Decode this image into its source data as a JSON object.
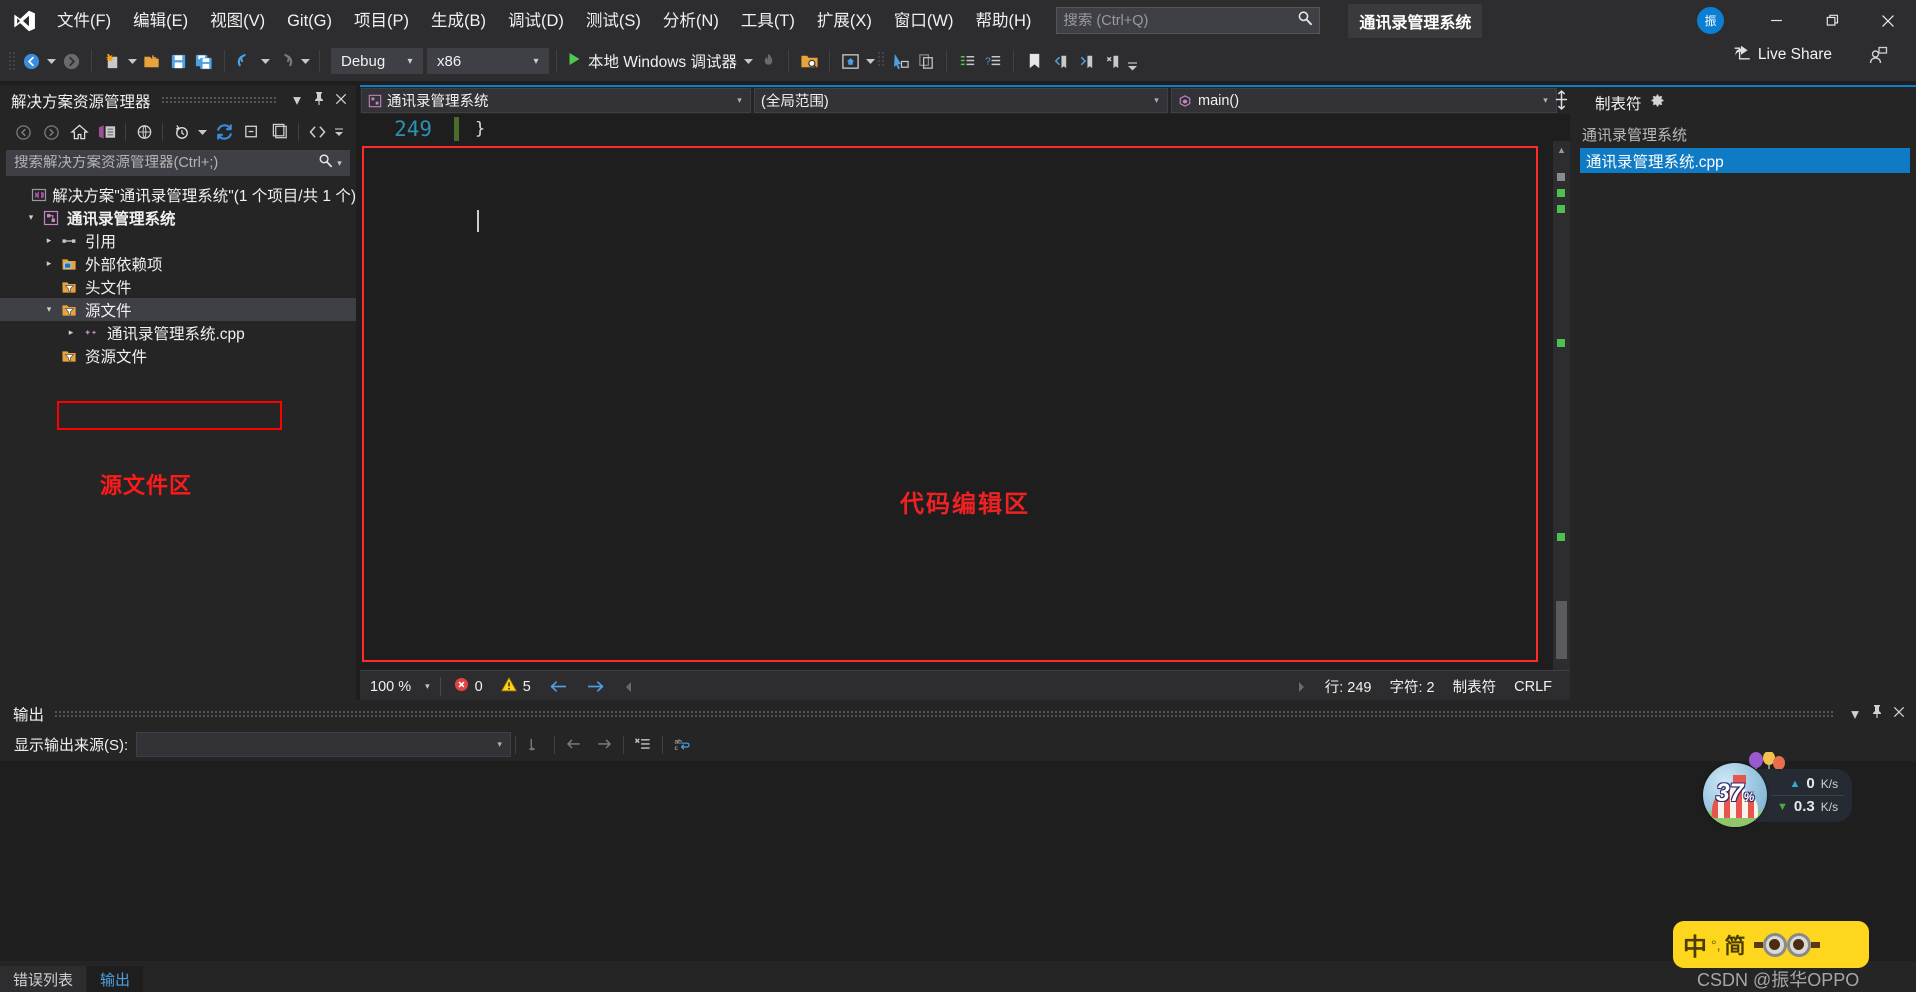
{
  "titlebar": {
    "logo_icon": "visual-studio-logo",
    "menus": [
      {
        "label": "文件(F)",
        "accel": "F"
      },
      {
        "label": "编辑(E)",
        "accel": "E"
      },
      {
        "label": "视图(V)",
        "accel": "V"
      },
      {
        "label": "Git(G)",
        "accel": "G"
      },
      {
        "label": "项目(P)",
        "accel": "P"
      },
      {
        "label": "生成(B)",
        "accel": "B"
      },
      {
        "label": "调试(D)",
        "accel": "D"
      },
      {
        "label": "测试(S)",
        "accel": "S"
      },
      {
        "label": "分析(N)",
        "accel": "N"
      },
      {
        "label": "工具(T)",
        "accel": "T"
      },
      {
        "label": "扩展(X)",
        "accel": "X"
      },
      {
        "label": "窗口(W)",
        "accel": "W"
      },
      {
        "label": "帮助(H)",
        "accel": "H"
      }
    ],
    "search": {
      "value": "",
      "placeholder": "搜索 (Ctrl+Q)"
    },
    "project_title": "通讯录管理系统",
    "avatar_initial": "振",
    "avatar_color": "#0b7fd4",
    "window_controls": [
      "minimize",
      "restore",
      "close"
    ]
  },
  "toolbar": {
    "config": "Debug",
    "platform": "x86",
    "run_label": "本地 Windows 调试器",
    "live_share": "Live Share"
  },
  "solution_explorer": {
    "title": "解决方案资源管理器",
    "search": {
      "value": "",
      "placeholder": "搜索解决方案资源管理器(Ctrl+;)"
    },
    "tree": [
      {
        "label": "解决方案\"通讯录管理系统\"(1 个项目/共 1 个)",
        "indent": 0,
        "twisty": "",
        "icon": "solution-icon",
        "bold": false,
        "selected": false,
        "highlighted": false
      },
      {
        "label": "通讯录管理系统",
        "indent": 1,
        "twisty": "expanded",
        "icon": "project-icon",
        "bold": true,
        "selected": false,
        "highlighted": false
      },
      {
        "label": "引用",
        "indent": 2,
        "twisty": "collapsed",
        "icon": "references-icon",
        "bold": false,
        "selected": false,
        "highlighted": false
      },
      {
        "label": "外部依赖项",
        "indent": 2,
        "twisty": "collapsed",
        "icon": "folder-dependency-icon",
        "bold": false,
        "selected": false,
        "highlighted": false
      },
      {
        "label": "头文件",
        "indent": 2,
        "twisty": "",
        "icon": "filter-folder-icon",
        "bold": false,
        "selected": false,
        "highlighted": false
      },
      {
        "label": "源文件",
        "indent": 2,
        "twisty": "expanded",
        "icon": "filter-folder-icon",
        "bold": false,
        "selected": true,
        "highlighted": false
      },
      {
        "label": "通讯录管理系统.cpp",
        "indent": 3,
        "twisty": "collapsed",
        "icon": "cpp-file-icon",
        "bold": false,
        "selected": false,
        "highlighted": true
      },
      {
        "label": "资源文件",
        "indent": 2,
        "twisty": "",
        "icon": "filter-folder-icon",
        "bold": false,
        "selected": false,
        "highlighted": false
      }
    ]
  },
  "annotations": {
    "source_area": "源文件区",
    "editor_area": "代码编辑区",
    "color": "#ff1a1a"
  },
  "editor": {
    "nav_project": "通讯录管理系统",
    "nav_scope": "(全局范围)",
    "nav_member": "main()",
    "line_number": "249",
    "code_text": "}"
  },
  "editor_status": {
    "zoom": "100 %",
    "errors": "0",
    "warnings": "5",
    "line": "行: 249",
    "column": "字符: 2",
    "tabs": "制表符",
    "eol": "CRLF"
  },
  "right_panel": {
    "title": "制表符",
    "group": "通讯录管理系统",
    "file": "通讯录管理系统.cpp",
    "selected_color": "#0f7bc4"
  },
  "output_panel": {
    "title": "输出",
    "source_label": "显示输出来源(S):",
    "source_value": "",
    "tabs": [
      {
        "label": "错误列表",
        "active": false
      },
      {
        "label": "输出",
        "active": true
      }
    ]
  },
  "net_widget": {
    "percent": "37",
    "percent_unit": "%",
    "upload": "0",
    "upload_unit": "K/s",
    "download": "0.3",
    "download_unit": "K/s"
  },
  "ime_bar": {
    "mode": "中",
    "punct": "°,",
    "script": "简"
  },
  "watermark": "CSDN @振华OPPO"
}
